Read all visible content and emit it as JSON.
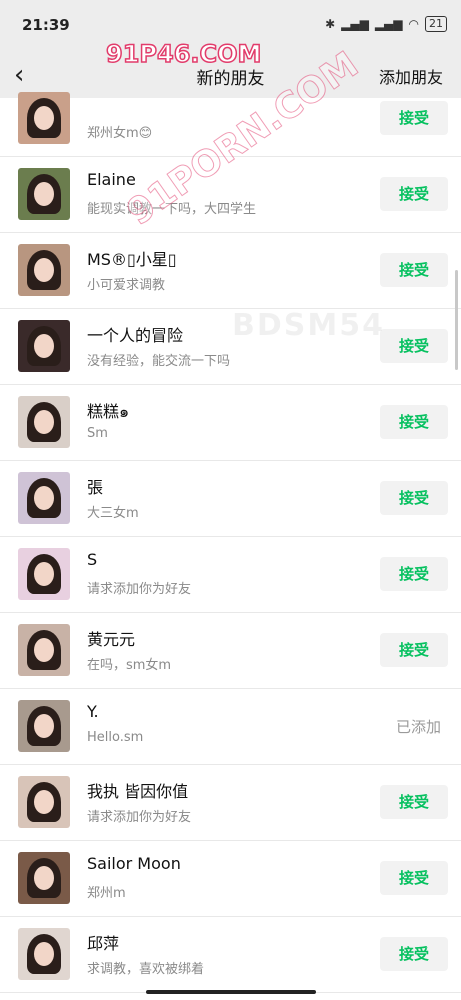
{
  "status": {
    "time": "21:39",
    "battery": "21",
    "icons": [
      "bluetooth-icon",
      "signal-icon",
      "hd-signal-icon",
      "wifi-icon"
    ]
  },
  "nav": {
    "back": "‹",
    "title": "新的朋友",
    "add_friend": "添加朋友"
  },
  "accept_label": "接受",
  "watermarks": {
    "top": "91P46.COM",
    "diagonal": "91PORN.COM",
    "faint": "BDSM54"
  },
  "rows": [
    {
      "name": "",
      "message": "郑州女m😊",
      "action": "accept",
      "avatar_bg": "#c9a08a"
    },
    {
      "name": "Elaine",
      "message": "能现实调教一下吗，大四学生",
      "action": "accept",
      "avatar_bg": "#6b7d4e"
    },
    {
      "name": "MS®▯小星▯",
      "message": "小可爱求调教",
      "action": "accept",
      "avatar_bg": "#b89680"
    },
    {
      "name": "一个人的冒险",
      "message": "没有经验，能交流一下吗",
      "action": "accept",
      "avatar_bg": "#3a2a2a"
    },
    {
      "name": "糕糕๑",
      "message": "Sm",
      "action": "accept",
      "avatar_bg": "#d9cfc8"
    },
    {
      "name": "張",
      "message": "大三女m",
      "action": "accept",
      "avatar_bg": "#cfc3d6"
    },
    {
      "name": "S",
      "message": "请求添加你为好友",
      "action": "accept",
      "avatar_bg": "#e8d0e0"
    },
    {
      "name": "黄元元",
      "message": "在吗，sm女m",
      "action": "accept",
      "avatar_bg": "#c8b2a6"
    },
    {
      "name": "Y.",
      "message": "Hello.sm",
      "action": "added",
      "status_text": "已添加",
      "avatar_bg": "#a89a8e"
    },
    {
      "name": "我执 皆因你值",
      "message": "请求添加你为好友",
      "action": "accept",
      "avatar_bg": "#d8c4b8"
    },
    {
      "name": "Sailor Moon",
      "message": "郑州m",
      "action": "accept",
      "avatar_bg": "#7a5a48"
    },
    {
      "name": "邱萍",
      "message": "求调教，喜欢被绑着",
      "action": "accept",
      "avatar_bg": "#e0d6d0"
    }
  ]
}
